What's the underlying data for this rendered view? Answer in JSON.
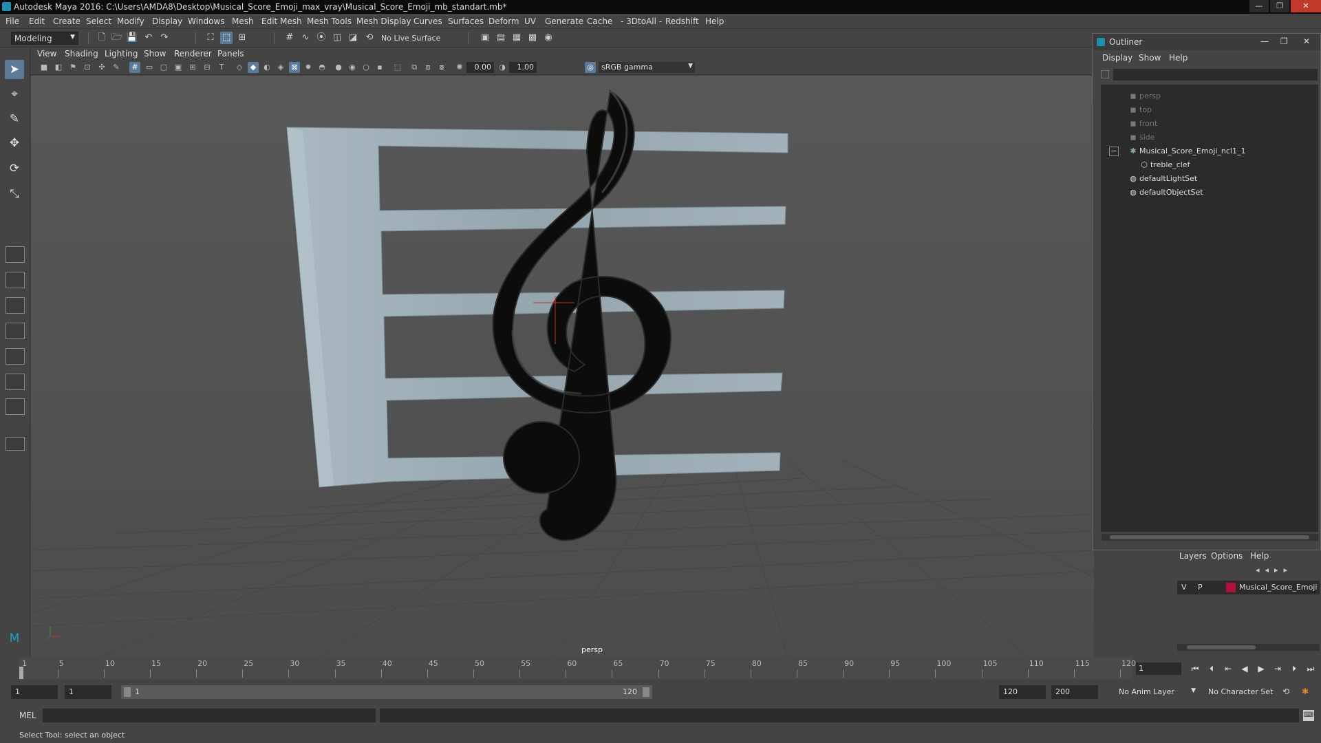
{
  "window": {
    "title": "Autodesk Maya 2016: C:\\Users\\AMDA8\\Desktop\\Musical_Score_Emoji_max_vray\\Musical_Score_Emoji_mb_standart.mb*",
    "controls": [
      "—",
      "❐",
      "✕"
    ]
  },
  "menu": [
    "File",
    "Edit",
    "Create",
    "Select",
    "Modify",
    "Display",
    "Windows",
    "Mesh",
    "Edit Mesh",
    "Mesh Tools",
    "Mesh Display",
    "Curves",
    "Surfaces",
    "Deform",
    "UV",
    "Generate",
    "Cache",
    "- 3DtoAll -",
    "Redshift",
    "Help"
  ],
  "shelf": {
    "mode": "Modeling",
    "live_surface": "No Live Surface"
  },
  "panel_menu": [
    "View",
    "Shading",
    "Lighting",
    "Show",
    "Renderer",
    "Panels"
  ],
  "panel_toolbar": {
    "exposure": "0.00",
    "gamma": "1.00",
    "color_space": "sRGB gamma"
  },
  "viewport": {
    "camera_label": "persp",
    "model_colors": {
      "staff": "#9aaab3",
      "clef": "#0c0c0c"
    }
  },
  "outliner": {
    "title": "Outliner",
    "menu": [
      "Display",
      "Show",
      "Help"
    ],
    "items": [
      {
        "label": "persp",
        "icon": "camera-icon",
        "depth": 1,
        "dim": true
      },
      {
        "label": "top",
        "icon": "camera-icon",
        "depth": 1,
        "dim": true
      },
      {
        "label": "front",
        "icon": "camera-icon",
        "depth": 1,
        "dim": true
      },
      {
        "label": "side",
        "icon": "camera-icon",
        "depth": 1,
        "dim": true
      },
      {
        "label": "Musical_Score_Emoji_ncl1_1",
        "icon": "group-icon",
        "depth": 1,
        "dim": false
      },
      {
        "label": "treble_clef",
        "icon": "mesh-icon",
        "depth": 2,
        "dim": false
      },
      {
        "label": "defaultLightSet",
        "icon": "set-icon",
        "depth": 1,
        "dim": false
      },
      {
        "label": "defaultObjectSet",
        "icon": "set-icon",
        "depth": 1,
        "dim": false
      }
    ]
  },
  "layers": {
    "menu": [
      "Layers",
      "Options",
      "Help"
    ],
    "row": {
      "v": "V",
      "p": "P",
      "name": "Musical_Score_Emoji",
      "color": "#b0103a"
    }
  },
  "timeline": {
    "ticks": [
      "1",
      "5",
      "10",
      "15",
      "20",
      "25",
      "30",
      "35",
      "40",
      "45",
      "50",
      "55",
      "60",
      "65",
      "70",
      "75",
      "80",
      "85",
      "90",
      "95",
      "100",
      "105",
      "110",
      "115",
      "120"
    ],
    "current_frame": "1"
  },
  "range": {
    "start": "1",
    "playback_start": "1",
    "slider_start": "1",
    "slider_end": "120",
    "end": "120",
    "anim_end": "200",
    "anim_layer": "No Anim Layer",
    "char_set": "No Character Set"
  },
  "command": {
    "label": "MEL"
  },
  "help_line": "Select Tool: select an object"
}
